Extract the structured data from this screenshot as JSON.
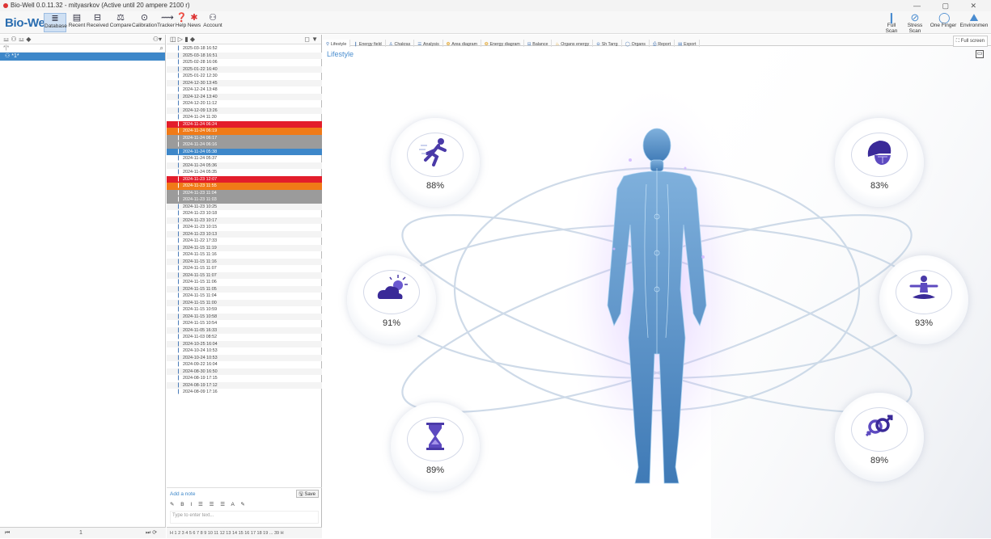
{
  "window": {
    "title": "Bio-Well 0.0.11.32 - mityasrkov (Active until 20 ampere 2100 r)",
    "controls": "— ▢ ✕"
  },
  "ribbon": {
    "logo": "Bio-Well",
    "items": [
      {
        "label": "Database",
        "icon": "database-icon"
      },
      {
        "label": "Recent",
        "icon": "recent-icon"
      },
      {
        "label": "Received",
        "icon": "received-icon"
      },
      {
        "label": "Compare",
        "icon": "compare-icon"
      },
      {
        "label": "Calibration",
        "icon": "calibration-icon"
      },
      {
        "label": "Tracker",
        "icon": "tracker-icon"
      },
      {
        "label": "Help",
        "icon": "help-icon"
      },
      {
        "label": "News",
        "icon": "news-icon"
      },
      {
        "label": "Account",
        "icon": "account-icon"
      }
    ],
    "right_items": [
      {
        "label": "Full Scan",
        "icon": "finger-icon"
      },
      {
        "label": "Stress Scan",
        "icon": "stress-icon"
      },
      {
        "label": "One Finger",
        "icon": "circle-icon"
      },
      {
        "label": "Environmen",
        "icon": "environment-icon"
      }
    ]
  },
  "people": {
    "search": "*|*",
    "user": "*1*",
    "footer": "1"
  },
  "sessions": [
    {
      "t": "2025-03-18 16:52",
      "c": ""
    },
    {
      "t": "2025-03-18 16:51",
      "c": ""
    },
    {
      "t": "2025-02-28 16:06",
      "c": ""
    },
    {
      "t": "2025-01-22 16:40",
      "c": ""
    },
    {
      "t": "2025-01-22 12:30",
      "c": ""
    },
    {
      "t": "2024-12-30 13:45",
      "c": ""
    },
    {
      "t": "2024-12-24 13:48",
      "c": ""
    },
    {
      "t": "2024-12-24 13:40",
      "c": ""
    },
    {
      "t": "2024-12-20 11:12",
      "c": ""
    },
    {
      "t": "2024-12-09 13:26",
      "c": ""
    },
    {
      "t": "2024-11-24 11:30",
      "c": ""
    },
    {
      "t": "2024-11-24 06:24",
      "c": "red"
    },
    {
      "t": "2024-11-24 06:19",
      "c": "orange"
    },
    {
      "t": "2024-11-24 06:17",
      "c": "gray"
    },
    {
      "t": "2024-11-24 06:16",
      "c": "gray"
    },
    {
      "t": "2024-11-24 05:38",
      "c": "blue"
    },
    {
      "t": "2024-11-24 05:37",
      "c": ""
    },
    {
      "t": "2024-11-24 05:36",
      "c": ""
    },
    {
      "t": "2024-11-24 05:35",
      "c": ""
    },
    {
      "t": "2024-11-23 12:07",
      "c": "red"
    },
    {
      "t": "2024-11-23 11:55",
      "c": "orange"
    },
    {
      "t": "2024-11-23 11:04",
      "c": "gray"
    },
    {
      "t": "2024-11-23 11:03",
      "c": "gray"
    },
    {
      "t": "2024-11-23 10:25",
      "c": ""
    },
    {
      "t": "2024-11-23 10:18",
      "c": ""
    },
    {
      "t": "2024-11-23 10:17",
      "c": ""
    },
    {
      "t": "2024-11-23 10:15",
      "c": ""
    },
    {
      "t": "2024-11-23 10:13",
      "c": ""
    },
    {
      "t": "2024-11-22 17:33",
      "c": ""
    },
    {
      "t": "2024-11-15 11:19",
      "c": ""
    },
    {
      "t": "2024-11-15 11:16",
      "c": ""
    },
    {
      "t": "2024-11-15 11:16",
      "c": ""
    },
    {
      "t": "2024-11-15 11:07",
      "c": ""
    },
    {
      "t": "2024-11-15 11:07",
      "c": ""
    },
    {
      "t": "2024-11-15 11:06",
      "c": ""
    },
    {
      "t": "2024-11-15 11:05",
      "c": ""
    },
    {
      "t": "2024-11-15 11:04",
      "c": ""
    },
    {
      "t": "2024-11-15 11:00",
      "c": ""
    },
    {
      "t": "2024-11-15 10:59",
      "c": ""
    },
    {
      "t": "2024-11-15 10:58",
      "c": ""
    },
    {
      "t": "2024-11-15 10:54",
      "c": ""
    },
    {
      "t": "2024-11-05 16:33",
      "c": ""
    },
    {
      "t": "2024-11-03 08:52",
      "c": ""
    },
    {
      "t": "2024-10-25 16:04",
      "c": ""
    },
    {
      "t": "2024-10-24 10:53",
      "c": ""
    },
    {
      "t": "2024-10-24 10:53",
      "c": ""
    },
    {
      "t": "2024-09-22 16:04",
      "c": ""
    },
    {
      "t": "2024-08-30 16:50",
      "c": ""
    },
    {
      "t": "2024-08-19 17:15",
      "c": ""
    },
    {
      "t": "2024-08-19 17:12",
      "c": ""
    },
    {
      "t": "2024-08-09 17:16",
      "c": ""
    }
  ],
  "notes": {
    "add": "Add a note",
    "save": "Save",
    "placeholder": "Type to enter text..."
  },
  "pager": "H  1 2 3 4 5 6 7 8 9 10 11 12 13 14 15 16 17 18 19 ... 39  H",
  "tabs": [
    "Lifestyle",
    "Energy field",
    "Chakras",
    "Analysis",
    "Area diagram",
    "Energy diagram",
    "Balance",
    "Organs energy",
    "Sh Tarrg",
    "Organs",
    "Report",
    "Export"
  ],
  "fullscreen": "Full screen",
  "main": {
    "title": "Lifestyle",
    "cards": [
      {
        "name": "running",
        "pct": "88%",
        "icon": "runner-icon"
      },
      {
        "name": "weather",
        "pct": "91%",
        "icon": "cloud-sun-icon"
      },
      {
        "name": "time",
        "pct": "89%",
        "icon": "hourglass-icon"
      },
      {
        "name": "nutrition",
        "pct": "83%",
        "icon": "fruit-icon"
      },
      {
        "name": "meditation",
        "pct": "93%",
        "icon": "meditation-icon"
      },
      {
        "name": "relationship",
        "pct": "89%",
        "icon": "gender-icon"
      }
    ]
  }
}
